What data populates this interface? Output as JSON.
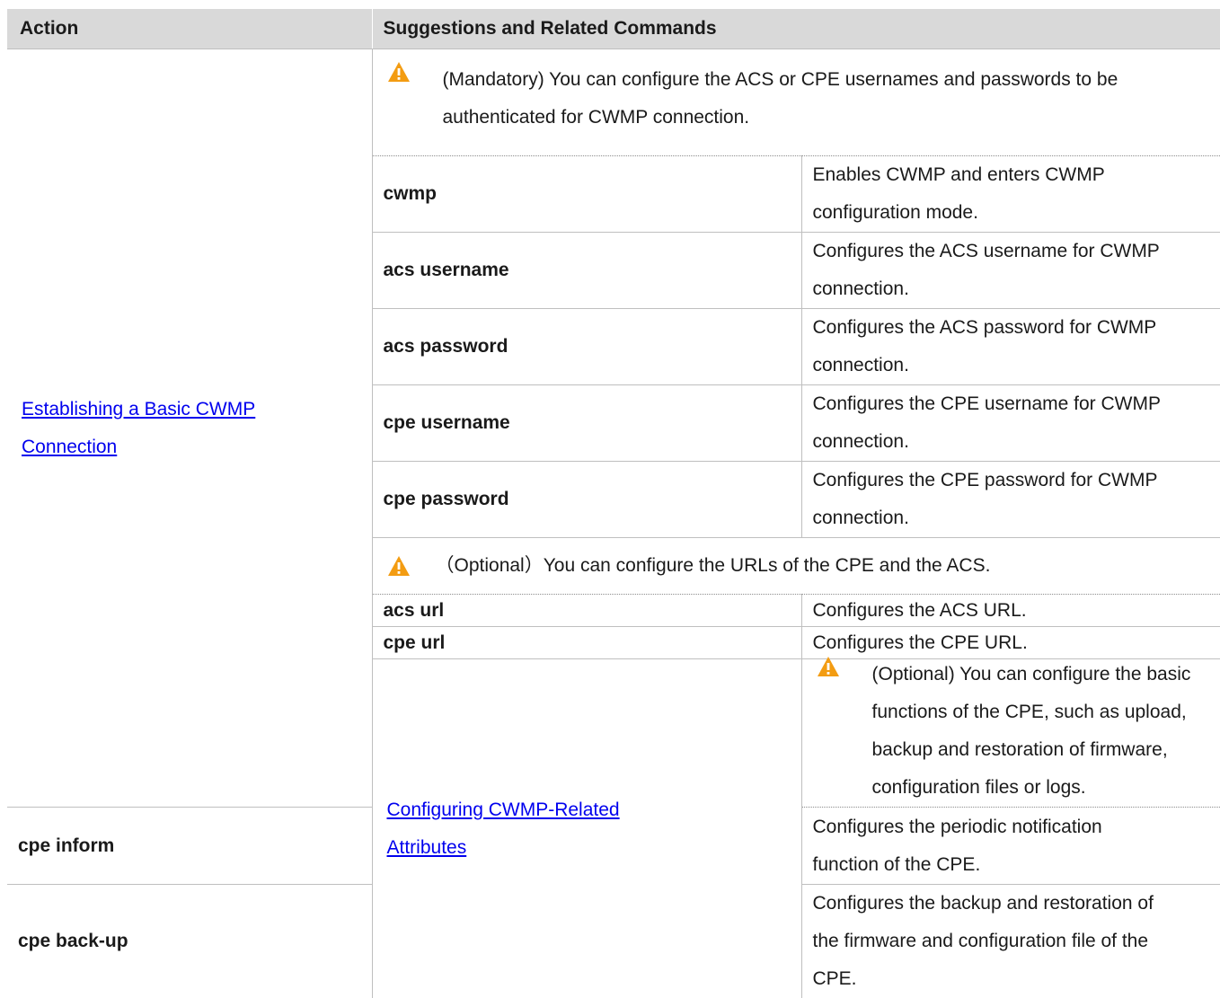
{
  "header": {
    "action": "Action",
    "suggestions": "Suggestions and Related Commands"
  },
  "colors": {
    "header_bg": "#d9d9d9",
    "link": "#0000ee",
    "warning_icon": "#f39c12"
  },
  "sections": [
    {
      "action_link_line1": "Establishing a Basic CWMP ",
      "action_link_line2": "Connection",
      "notes": [
        {
          "icon": "warning-icon",
          "line1": "(Mandatory) You can configure the ACS or CPE usernames and passwords to be",
          "line2": "authenticated for CWMP connection."
        }
      ],
      "commands": [
        {
          "command": "cwmp",
          "desc1": "Enables CWMP and enters CWMP",
          "desc2": "configuration mode."
        },
        {
          "command": "acs username",
          "desc1": "Configures the ACS username for CWMP",
          "desc2": "connection."
        },
        {
          "command": "acs password",
          "desc1": "Configures the ACS password for CWMP",
          "desc2": "connection."
        },
        {
          "command": "cpe username",
          "desc1": "Configures the CPE username for CWMP",
          "desc2": "connection."
        },
        {
          "command": "cpe password",
          "desc1": "Configures the CPE password for CWMP",
          "desc2": "connection."
        }
      ],
      "note2": {
        "icon": "warning-icon",
        "line1": "（Optional）You can configure the URLs of the CPE and the ACS."
      },
      "commands2": [
        {
          "command": "acs url",
          "desc1": "Configures the ACS URL."
        },
        {
          "command": "cpe url",
          "desc1": "Configures the CPE URL."
        }
      ]
    },
    {
      "action_link_line1": "Configuring CWMP-Related ",
      "action_link_line2": "Attributes",
      "notes": [
        {
          "icon": "warning-icon",
          "line1": "(Optional) You can configure the basic functions of the CPE, such as upload,",
          "line2": "backup and restoration of firmware, configuration files or logs."
        }
      ],
      "commands": [
        {
          "command": "cpe inform",
          "desc1": "Configures the periodic notification",
          "desc2": "function of the CPE."
        },
        {
          "command": "cpe back-up",
          "desc1": "Configures the backup and restoration of",
          "desc2": "the firmware and configuration file of the",
          "desc3": "CPE."
        }
      ]
    }
  ]
}
